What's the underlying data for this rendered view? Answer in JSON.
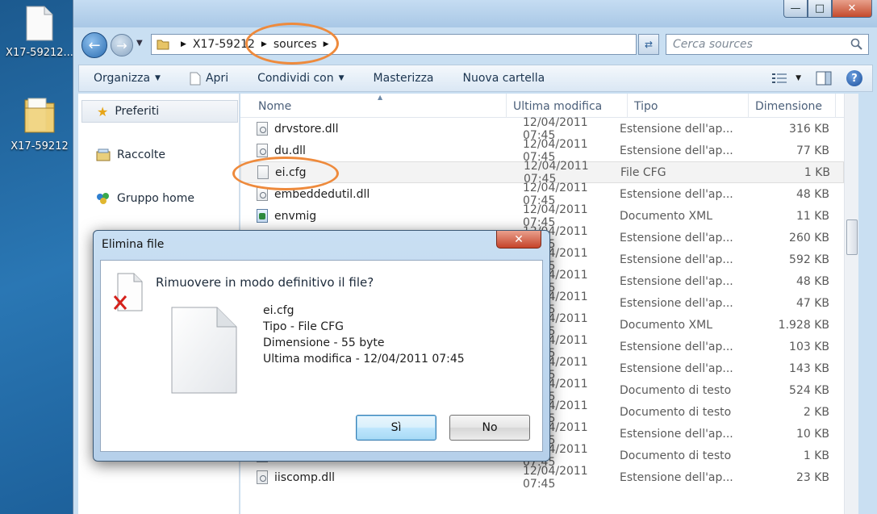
{
  "desktop": {
    "icons": [
      {
        "label": "X17-59212..."
      },
      {
        "label": "X17-59212"
      }
    ]
  },
  "window": {
    "controls": {
      "minimize": "—",
      "maximize": "□",
      "close": "✕"
    }
  },
  "address": {
    "crumbs": [
      "X17-59212",
      "sources"
    ],
    "search_placeholder": "Cerca sources"
  },
  "toolbar": {
    "organize": "Organizza",
    "open": "Apri",
    "share": "Condividi con",
    "burn": "Masterizza",
    "new_folder": "Nuova cartella"
  },
  "navpane": {
    "favorites": "Preferiti",
    "libraries": "Raccolte",
    "homegroup": "Gruppo home"
  },
  "columns": {
    "name": "Nome",
    "modified": "Ultima modifica",
    "type": "Tipo",
    "size": "Dimensione"
  },
  "files": [
    {
      "name": "drvstore.dll",
      "date": "12/04/2011 07:45",
      "type": "Estensione dell'ap...",
      "size": "316 KB",
      "icon": "dll"
    },
    {
      "name": "du.dll",
      "date": "12/04/2011 07:45",
      "type": "Estensione dell'ap...",
      "size": "77 KB",
      "icon": "dll"
    },
    {
      "name": "ei.cfg",
      "date": "12/04/2011 07:45",
      "type": "File CFG",
      "size": "1 KB",
      "icon": "cfg"
    },
    {
      "name": "embeddedutil.dll",
      "date": "12/04/2011 07:45",
      "type": "Estensione dell'ap...",
      "size": "48 KB",
      "icon": "dll"
    },
    {
      "name": "envmig",
      "date": "12/04/2011 07:45",
      "type": "Documento XML",
      "size": "11 KB",
      "icon": "xml"
    },
    {
      "name": "",
      "date": "12/04/2011 07:45",
      "type": "Estensione dell'ap...",
      "size": "260 KB",
      "icon": "dll"
    },
    {
      "name": "",
      "date": "12/04/2011 07:45",
      "type": "Estensione dell'ap...",
      "size": "592 KB",
      "icon": "dll"
    },
    {
      "name": "",
      "date": "12/04/2011 07:45",
      "type": "Estensione dell'ap...",
      "size": "48 KB",
      "icon": "dll"
    },
    {
      "name": "",
      "date": "12/04/2011 07:45",
      "type": "Estensione dell'ap...",
      "size": "47 KB",
      "icon": "dll"
    },
    {
      "name": "",
      "date": "12/04/2011 07:45",
      "type": "Documento XML",
      "size": "1.928 KB",
      "icon": "xml"
    },
    {
      "name": "",
      "date": "12/04/2011 07:45",
      "type": "Estensione dell'ap...",
      "size": "103 KB",
      "icon": "dll"
    },
    {
      "name": "",
      "date": "12/04/2011 07:45",
      "type": "Estensione dell'ap...",
      "size": "143 KB",
      "icon": "dll"
    },
    {
      "name": "",
      "date": "12/04/2011 07:45",
      "type": "Documento di testo",
      "size": "524 KB",
      "icon": "txt"
    },
    {
      "name": "",
      "date": "12/04/2011 07:45",
      "type": "Documento di testo",
      "size": "2 KB",
      "icon": "txt"
    },
    {
      "name": "",
      "date": "12/04/2011 07:45",
      "type": "Estensione dell'ap...",
      "size": "10 KB",
      "icon": "dll"
    },
    {
      "name": "",
      "date": "12/04/2011 07:45",
      "type": "Documento di testo",
      "size": "1 KB",
      "icon": "txt"
    },
    {
      "name": "iiscomp.dll",
      "date": "12/04/2011 07:45",
      "type": "Estensione dell'ap...",
      "size": "23 KB",
      "icon": "dll"
    }
  ],
  "selected_index": 2,
  "dialog": {
    "title": "Elimina file",
    "close": "✕",
    "question": "Rimuovere in modo definitivo il file?",
    "file_name": "ei.cfg",
    "file_type": "Tipo - File CFG",
    "file_size": "Dimensione - 55 byte",
    "file_modified": "Ultima modifica - 12/04/2011 07:45",
    "yes": "Sì",
    "no": "No"
  },
  "colors": {
    "annotation": "#ee8a3c",
    "accent": "#3c7fb1"
  }
}
